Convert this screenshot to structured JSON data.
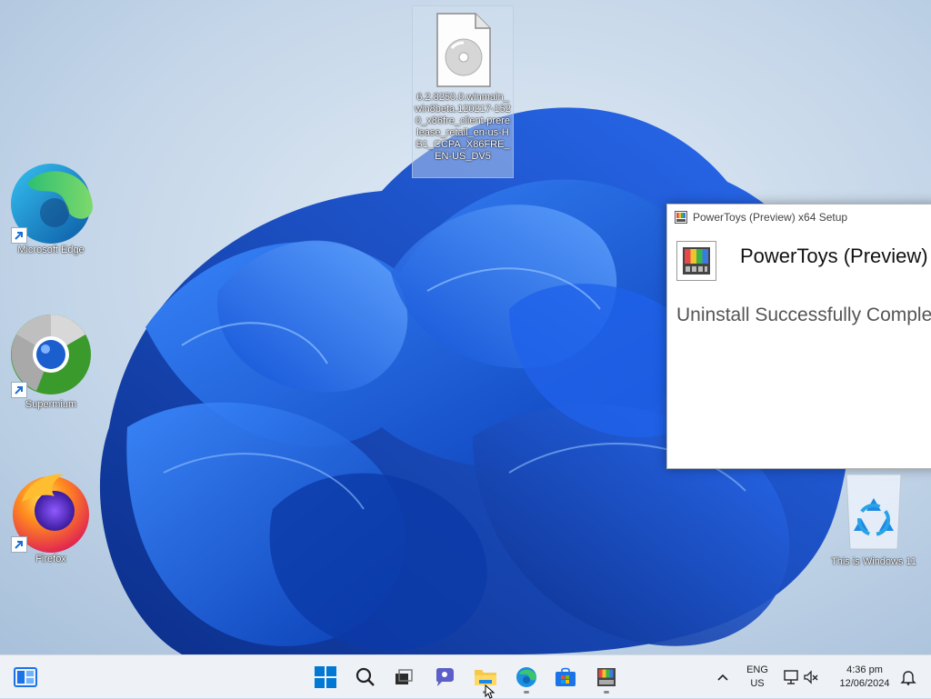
{
  "desktop": {
    "icons": [
      {
        "label": "Microsoft Edge"
      },
      {
        "label": "Supermium"
      },
      {
        "label": "Firefox"
      }
    ],
    "selected_file": {
      "label": "6.2.8250.0.winmain_win8beta.120217-1520_x86fre_client-prerelease_retail_en-us-HB1_CCPA_X86FRE_EN-US_DV5"
    },
    "recycle_bin": {
      "label": "This is Windows 11"
    }
  },
  "setup_window": {
    "title": "PowerToys (Preview) x64 Setup",
    "heading": "PowerToys (Preview)",
    "message": "Uninstall Successfully Complete"
  },
  "taskbar": {
    "apps": [
      "widgets",
      "start",
      "search",
      "task-view",
      "chat",
      "file-explorer",
      "edge",
      "store",
      "powertoys"
    ],
    "language_line1": "ENG",
    "language_line2": "US",
    "time": "4:36 pm",
    "date": "12/06/2024"
  },
  "colors": {
    "accent": "#0067c0",
    "wallpaper_bloom": "#1a5fe6",
    "taskbar_bg": "#eef1f6"
  }
}
